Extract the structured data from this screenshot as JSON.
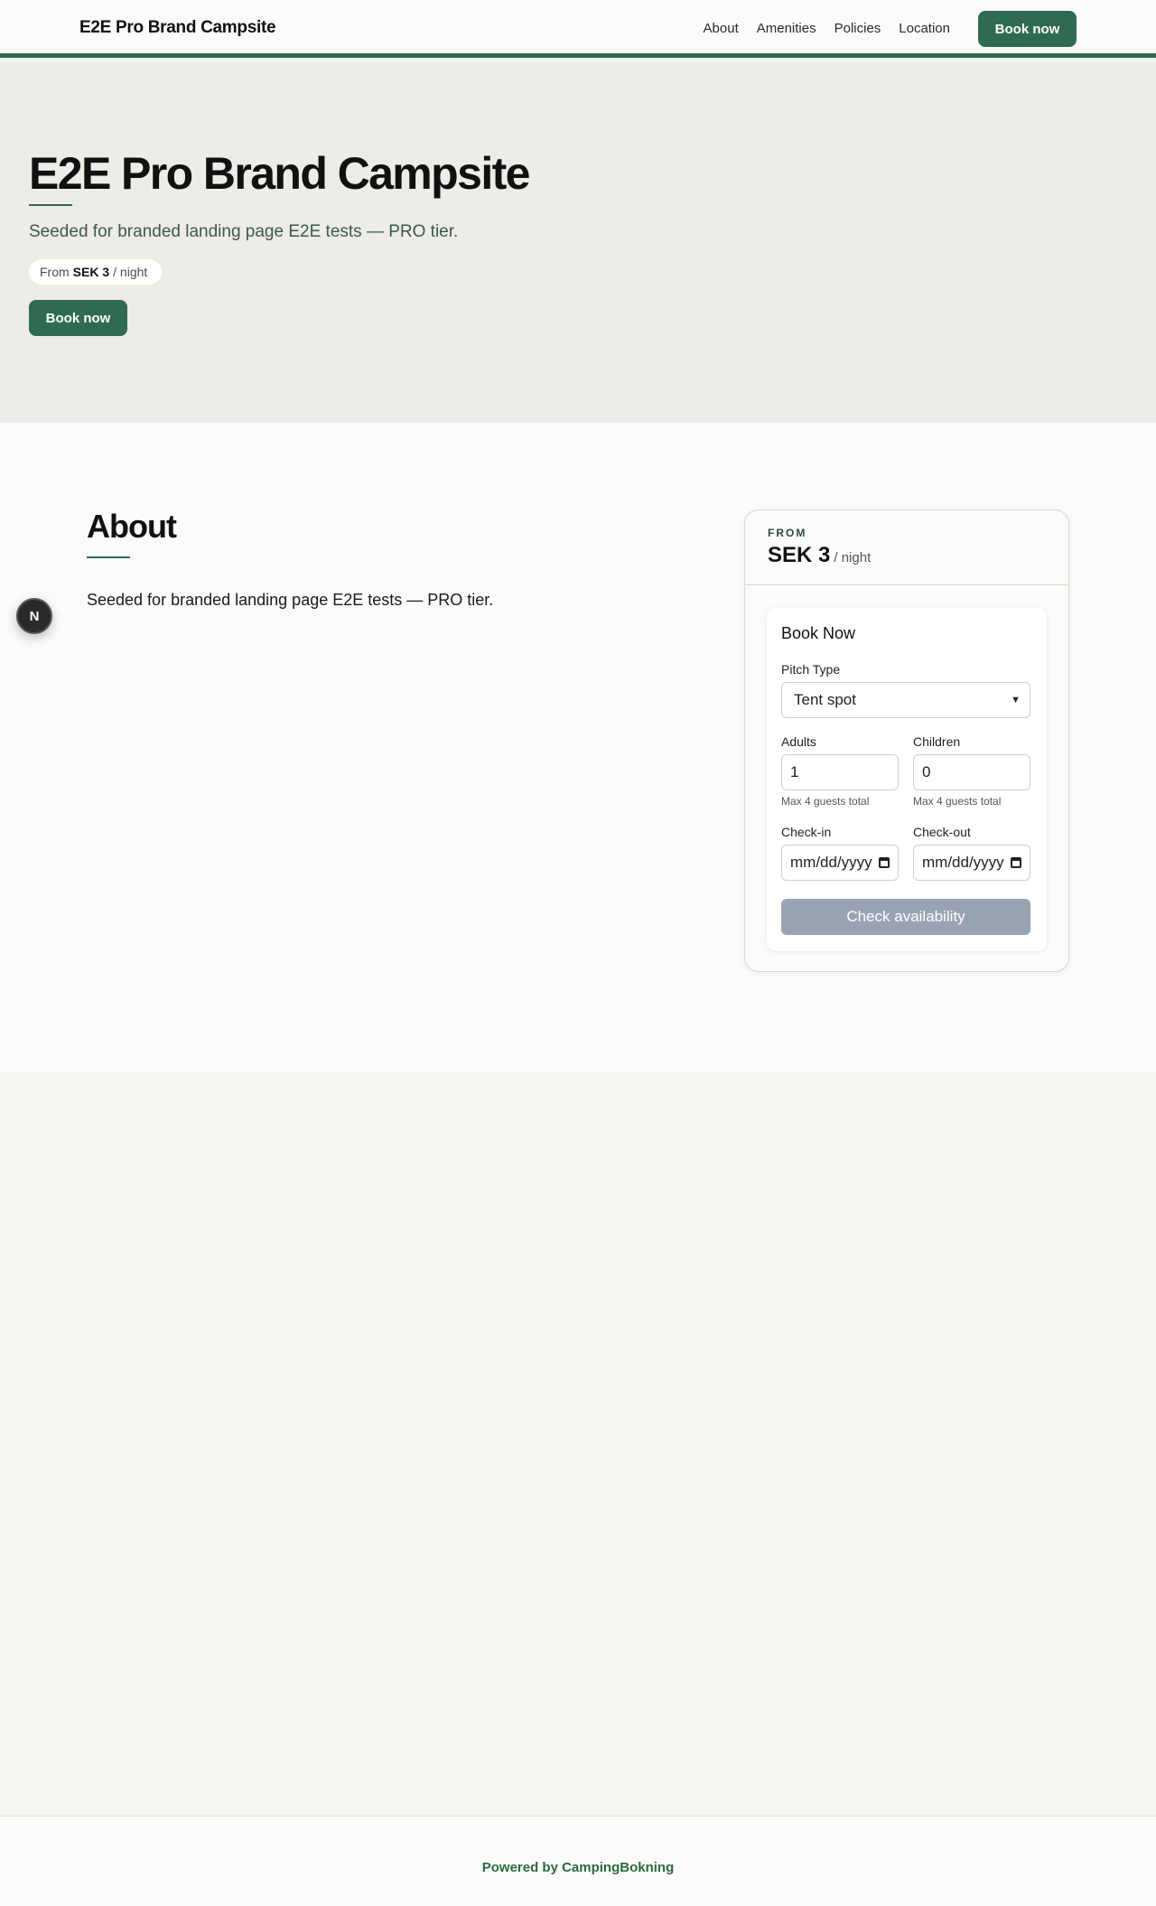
{
  "header": {
    "brand": "E2E Pro Brand Campsite",
    "nav": [
      "About",
      "Amenities",
      "Policies",
      "Location"
    ],
    "book_label": "Book now"
  },
  "hero": {
    "title": "E2E Pro Brand Campsite",
    "subtitle": "Seeded for branded landing page E2E tests — PRO tier.",
    "price_prefix": "From",
    "price_value": "SEK 3",
    "price_suffix": "/ night",
    "book_label": "Book now"
  },
  "about": {
    "title": "About",
    "text": "Seeded for branded landing page E2E tests — PRO tier.",
    "badge_letter": "N"
  },
  "booking": {
    "from_label": "FROM",
    "price": "SEK 3",
    "per": "/ night",
    "form_title": "Book Now",
    "pitch_label": "Pitch Type",
    "pitch_value": "Tent spot",
    "adults_label": "Adults",
    "adults_value": "1",
    "children_label": "Children",
    "children_value": "0",
    "guest_hint": "Max 4 guests total",
    "checkin_label": "Check-in",
    "checkin_placeholder": "mm/dd/yyyy",
    "checkout_label": "Check-out",
    "checkout_placeholder": "mm/dd/yyyy",
    "check_label": "Check availability"
  },
  "footer": {
    "text": "Powered by CampingBokning"
  },
  "colors": {
    "brand_green": "#2f6b50",
    "hero_bg": "#edece7",
    "disabled_button": "#9aa3b2",
    "footer_link": "#2a6a3f"
  }
}
